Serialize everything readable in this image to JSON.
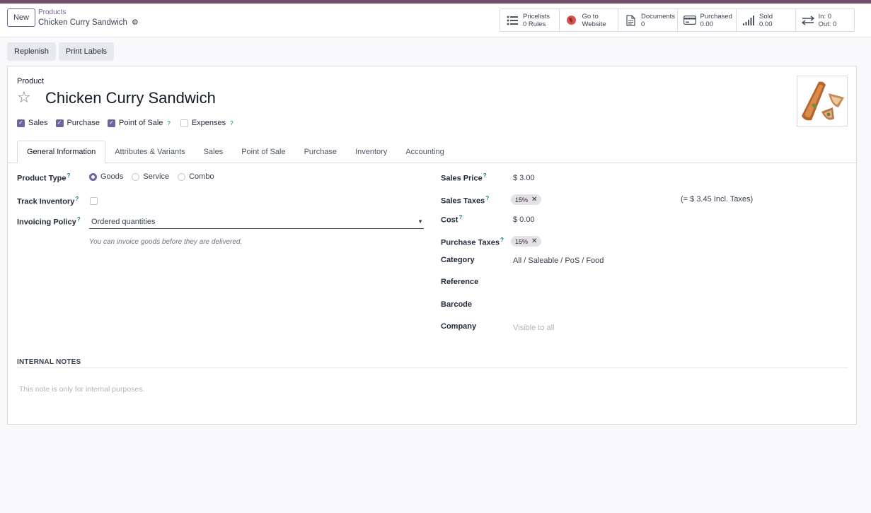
{
  "control_panel": {
    "new_label": "New",
    "breadcrumb_parent": "Products",
    "breadcrumb_current": "Chicken Curry Sandwich"
  },
  "smart_buttons": [
    {
      "icon": "list-icon",
      "line1": "Pricelists",
      "line2": "0 Rules"
    },
    {
      "icon": "globe-icon",
      "line1": "Go to",
      "line2": "Website"
    },
    {
      "icon": "document-icon",
      "line1": "Documents",
      "line2": "0"
    },
    {
      "icon": "credit-card-icon",
      "line1": "Purchased",
      "line2": "0.00"
    },
    {
      "icon": "signal-bars-icon",
      "line1": "Sold",
      "line2": "0.00"
    },
    {
      "icon": "exchange-arrows-icon",
      "line1": "In: 0",
      "line2": "Out: 0"
    }
  ],
  "actions": {
    "replenish": "Replenish",
    "print_labels": "Print Labels"
  },
  "product": {
    "label": "Product",
    "name": "Chicken Curry Sandwich"
  },
  "checkboxes": [
    {
      "label": "Sales",
      "checked": true,
      "help": false
    },
    {
      "label": "Purchase",
      "checked": true,
      "help": false
    },
    {
      "label": "Point of Sale",
      "checked": true,
      "help": true
    },
    {
      "label": "Expenses",
      "checked": false,
      "help": true
    }
  ],
  "tabs": [
    "General Information",
    "Attributes & Variants",
    "Sales",
    "Point of Sale",
    "Purchase",
    "Inventory",
    "Accounting"
  ],
  "help_mark": "?",
  "left_fields": {
    "product_type_label": "Product Type",
    "product_type_options": [
      "Goods",
      "Service",
      "Combo"
    ],
    "product_type_selected": "Goods",
    "track_inventory_label": "Track Inventory",
    "invoicing_policy_label": "Invoicing Policy",
    "invoicing_policy_value": "Ordered quantities",
    "invoicing_hint": "You can invoice goods before they are delivered."
  },
  "right_fields": {
    "sales_price_label": "Sales Price",
    "sales_price_value": "$ 3.00",
    "sales_taxes_label": "Sales Taxes",
    "sales_taxes_tag": "15%",
    "incl_taxes": "(= $ 3.45 Incl. Taxes)",
    "cost_label": "Cost",
    "cost_value": "$ 0.00",
    "purchase_taxes_label": "Purchase Taxes",
    "purchase_taxes_tag": "15%",
    "category_label": "Category",
    "category_value": "All / Saleable / PoS / Food",
    "reference_label": "Reference",
    "barcode_label": "Barcode",
    "company_label": "Company",
    "company_placeholder": "Visible to all"
  },
  "notes": {
    "title": "INTERNAL NOTES",
    "placeholder": "This note is only for internal purposes."
  },
  "colors": {
    "brand": "#714b67",
    "accent": "#71639e",
    "help": "#017e84"
  }
}
